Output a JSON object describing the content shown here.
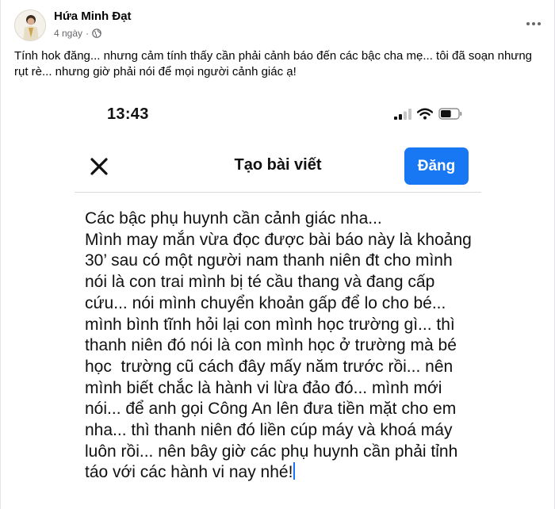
{
  "post": {
    "author": "Hứa Minh Đạt",
    "time": "4 ngày",
    "privacy_icon": "globe-icon",
    "text": "Tính hok đăng... nhưng cảm tính thấy cần phải cảnh báo đến các bậc cha mẹ... tôi đã soạn nhưng rụt rè... nhưng giờ phải nói để mọi người cảnh giác ạ!",
    "more_icon": "more-horizontal-icon"
  },
  "screenshot": {
    "status_time": "13:43",
    "status_icons": [
      "signal-icon",
      "wifi-icon",
      "battery-icon"
    ],
    "battery_level": 0.6,
    "composer_title": "Tạo bài viết",
    "post_button_label": "Đăng",
    "close_icon": "close-icon",
    "body_text": "Các bậc phụ huynh cần cảnh giác nha...\nMình may mắn vừa đọc được bài báo này là khoảng 30’ sau có một người nam thanh niên đt cho mình nói là con trai mình bị té cầu thang và đang cấp cứu... nói mình chuyển khoản gấp để lo cho bé... mình bình tĩnh hỏi lại con mình học trường gì... thì thanh niên đó nói là con mình học ở trường mà bé học  trường cũ cách đây mấy năm trước rồi... nên mình biết chắc là hành vi lừa đảo đó... mình mới nói... để anh gọi Công An lên đưa tiền mặt cho em nha... thì thanh niên đó liền cúp máy và khoá máy luôn rồi... nên bây giờ các phụ huynh cần phải tỉnh táo với các hành vi nay nhé!"
  },
  "colors": {
    "accent": "#1877f2",
    "text_primary": "#050505",
    "text_secondary": "#65676b"
  }
}
